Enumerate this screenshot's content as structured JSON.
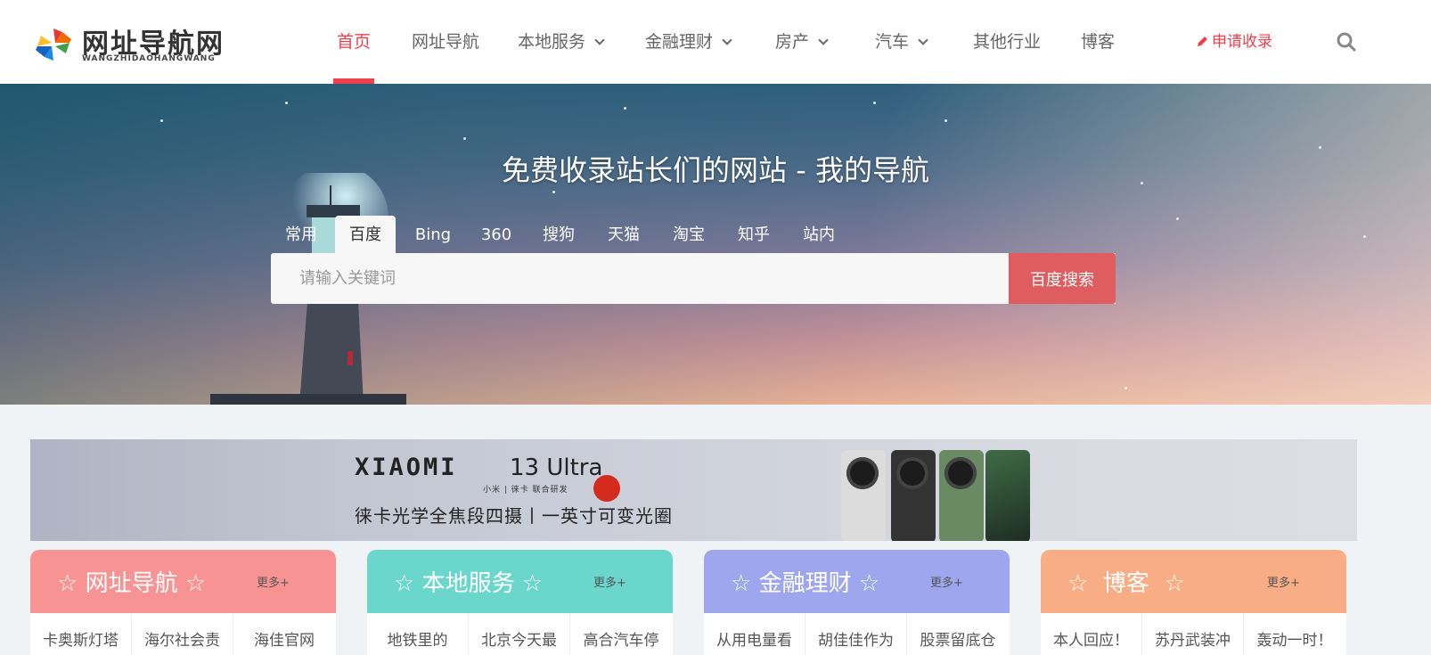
{
  "logo": {
    "title": "网址导航网",
    "subtitle": "WANGZHIDAOHANGWANG"
  },
  "nav": {
    "items": [
      {
        "label": "首页",
        "active": true
      },
      {
        "label": "网址导航"
      },
      {
        "label": "本地服务",
        "dropdown": true
      },
      {
        "label": "金融理财",
        "dropdown": true
      },
      {
        "label": "房产",
        "dropdown": true
      },
      {
        "label": "汽车",
        "dropdown": true
      },
      {
        "label": "其他行业"
      },
      {
        "label": "博客"
      }
    ],
    "apply_label": "申请收录",
    "search_icon": "search-icon"
  },
  "hero": {
    "title": "免费收录站长们的网站 - 我的导航",
    "tabs": [
      "常用",
      "百度",
      "Bing",
      "360",
      "搜狗",
      "天猫",
      "淘宝",
      "知乎",
      "站内"
    ],
    "active_tab": "百度",
    "search_placeholder": "请输入关键词",
    "search_button": "百度搜索"
  },
  "banner": {
    "brand": "XIAOMI",
    "model": "13 Ultra",
    "small_text": "小米 | 徕卡  联合研发",
    "slogan": "徕卡光学全焦段四摄丨一英寸可变光圈"
  },
  "cards": [
    {
      "title": "网址导航",
      "more": "更多+",
      "color": "#f79393",
      "links": [
        "卡奥斯灯塔",
        "海尔社会责",
        "海佳官网"
      ]
    },
    {
      "title": "本地服务",
      "more": "更多+",
      "color": "#6bd6cb",
      "links": [
        "地铁里的",
        "北京今天最",
        "高合汽车停"
      ]
    },
    {
      "title": "金融理财",
      "more": "更多+",
      "color": "#9ea7ee",
      "links": [
        "从用电量看",
        "胡佳佳作为",
        "股票留底仓"
      ]
    },
    {
      "title": "博客",
      "more": "更多+",
      "color": "#f9ad84",
      "links": [
        "本人回应！",
        "苏丹武装冲",
        "轰动一时！"
      ]
    }
  ],
  "colors": {
    "accent": "#f1404b",
    "search_button": "#e05d5f"
  }
}
